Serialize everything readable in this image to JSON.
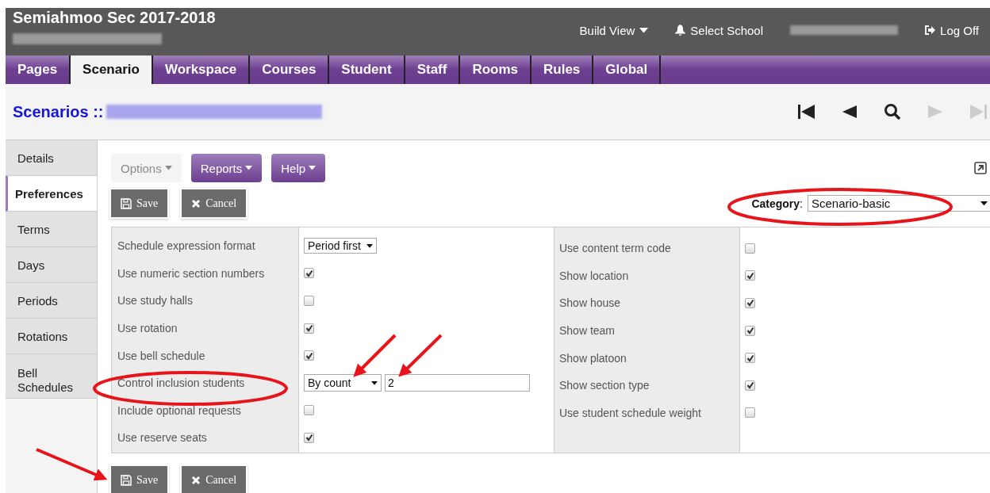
{
  "header": {
    "school": "Semiahmoo Sec 2017-2018",
    "menu": [
      {
        "kind": "dropdown",
        "label": "Build View"
      },
      {
        "kind": "bell",
        "label": "Select School"
      },
      {
        "kind": "user"
      },
      {
        "kind": "logoff",
        "label": "Log Off"
      }
    ]
  },
  "tabs": [
    {
      "label": "Pages",
      "selected": false
    },
    {
      "label": "Scenario",
      "selected": true
    },
    {
      "label": "Workspace",
      "selected": false
    },
    {
      "label": "Courses",
      "selected": false
    },
    {
      "label": "Student",
      "selected": false
    },
    {
      "label": "Staff",
      "selected": false
    },
    {
      "label": "Rooms",
      "selected": false
    },
    {
      "label": "Rules",
      "selected": false
    },
    {
      "label": "Global",
      "selected": false
    }
  ],
  "page_title": "Scenarios ::",
  "record_nav": [
    {
      "kind": "first",
      "disabled": false
    },
    {
      "kind": "prev",
      "disabled": false
    },
    {
      "kind": "search",
      "disabled": false
    },
    {
      "kind": "next",
      "disabled": true
    },
    {
      "kind": "last",
      "disabled": true
    }
  ],
  "sidebar": {
    "items": [
      {
        "label": "Details",
        "selected": false
      },
      {
        "label": "Preferences",
        "selected": true
      },
      {
        "label": "Terms",
        "selected": false
      },
      {
        "label": "Days",
        "selected": false
      },
      {
        "label": "Periods",
        "selected": false
      },
      {
        "label": "Rotations",
        "selected": false
      },
      {
        "label": "Bell Schedules",
        "selected": false
      }
    ]
  },
  "menu_buttons": [
    {
      "label": "Options",
      "disabled": true
    },
    {
      "label": "Reports",
      "disabled": false
    },
    {
      "label": "Help",
      "disabled": false
    }
  ],
  "actions_top": [
    {
      "kind": "save",
      "label": "Save"
    },
    {
      "kind": "cancel",
      "label": "Cancel"
    }
  ],
  "category": {
    "label": "**Category**:",
    "value": "Scenario-basic"
  },
  "prefs_left": [
    {
      "label": "Schedule expression format",
      "kind": "select",
      "value": "Period first"
    },
    {
      "label": "Use numeric section numbers",
      "kind": "checkbox",
      "checked": true
    },
    {
      "label": "Use study halls",
      "kind": "checkbox",
      "checked": false
    },
    {
      "label": "Use rotation",
      "kind": "checkbox",
      "checked": true
    },
    {
      "label": "Use bell schedule",
      "kind": "checkbox",
      "checked": true
    },
    {
      "label": "Control inclusion students",
      "kind": "select_input",
      "value": "By count",
      "input_value": "2"
    },
    {
      "label": "Include optional requests",
      "kind": "checkbox",
      "checked": false
    },
    {
      "label": "Use reserve seats",
      "kind": "checkbox",
      "checked": true
    }
  ],
  "prefs_right": [
    {
      "label": "Use content term code",
      "kind": "checkbox",
      "checked": false
    },
    {
      "label": "Show location",
      "kind": "checkbox",
      "checked": true
    },
    {
      "label": "Show house",
      "kind": "checkbox",
      "checked": true
    },
    {
      "label": "Show team",
      "kind": "checkbox",
      "checked": true
    },
    {
      "label": "Show platoon",
      "kind": "checkbox",
      "checked": true
    },
    {
      "label": "Show section type",
      "kind": "checkbox",
      "checked": true
    },
    {
      "label": "Use student schedule weight",
      "kind": "checkbox",
      "checked": false
    }
  ],
  "actions_bottom": [
    {
      "kind": "save",
      "label": "Save"
    },
    {
      "kind": "cancel",
      "label": "Cancel"
    }
  ]
}
